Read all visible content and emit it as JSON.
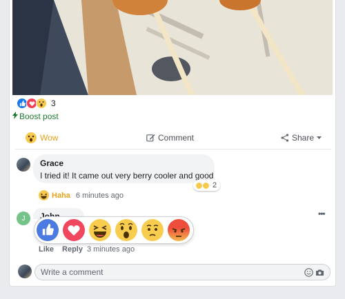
{
  "post": {
    "reaction_count": "3",
    "boost_label": "Boost post"
  },
  "actions": {
    "wow_label": "Wow",
    "comment_label": "Comment",
    "share_label": "Share"
  },
  "comments": [
    {
      "author": "Grace",
      "text": "I tried it! It came out very berry cooler and good",
      "reaction_count": "2",
      "my_reaction": "Haha",
      "time": "6 minutes ago"
    },
    {
      "author": "John",
      "avatar_initial": "J",
      "like_label": "Like",
      "reply_label": "Reply",
      "time": "3 minutes ago"
    }
  ],
  "reaction_picker": [
    "like",
    "love",
    "haha",
    "wow",
    "sad",
    "angry"
  ],
  "composer": {
    "placeholder": "Write a comment"
  },
  "icons": [
    "like-icon",
    "love-icon",
    "wow-icon",
    "bolt-icon",
    "comment-icon",
    "share-icon",
    "haha-icon",
    "more-icon",
    "emoji-icon",
    "camera-icon"
  ],
  "colors": {
    "like_blue": "#1877f2",
    "love_red": "#f33e58",
    "wow_yellow": "#f7c94e",
    "haha_text": "#e7a21b",
    "boost_green": "#1c7a2e"
  }
}
